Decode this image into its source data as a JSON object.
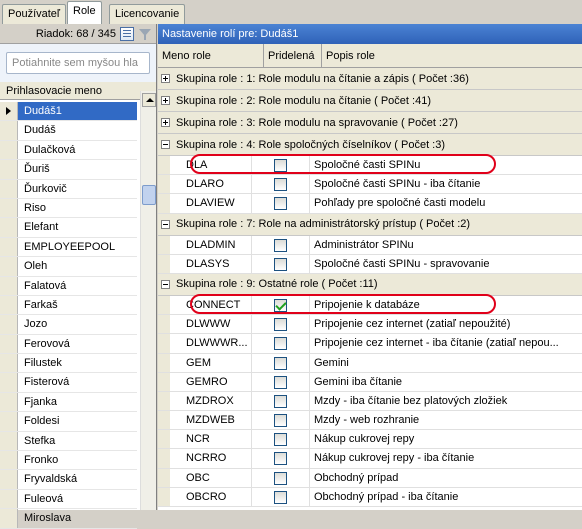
{
  "tabs": [
    "Používateľ",
    "Role",
    "Licencovanie"
  ],
  "left": {
    "row_info": "Riadok: 68 / 345",
    "search_placeholder": "Potiahnite sem myšou hla",
    "column_header": "Prihlasovacie meno",
    "users": [
      "Dudáš1",
      "Dudáš",
      "Dulačková",
      "Ďuriš",
      "Ďurkovič",
      "Riso",
      "Elefant",
      "EMPLOYEEPOOL",
      "Oleh",
      "Falatová",
      "Farkaš",
      "Jozo",
      "Ferovová",
      "Filustek",
      "Fisterová",
      "Fjanka",
      "Foldesi",
      "Stefka",
      "Fronko",
      "Fryvaldská",
      "Fuleová",
      "Miroslava"
    ],
    "selected_index": 0
  },
  "right": {
    "title": "Nastavenie rolí pre: Dudáš1",
    "columns": [
      "Meno role",
      "Pridelená",
      "Popis role"
    ],
    "groups": [
      {
        "label": "Skupina role : 1: Role modulu na čítanie a zápis ( Počet :36)",
        "expanded": false,
        "rows": []
      },
      {
        "label": "Skupina role : 2: Role modulu na čítanie ( Počet :41)",
        "expanded": false,
        "rows": []
      },
      {
        "label": "Skupina role : 3: Role modulu na spravovanie ( Počet :27)",
        "expanded": false,
        "rows": []
      },
      {
        "label": "Skupina role : 4: Role spoločných číselníkov ( Počet :3)",
        "expanded": true,
        "rows": [
          {
            "name": "DLA",
            "checked": false,
            "desc": "Spoločné časti SPINu",
            "highlight": true
          },
          {
            "name": "DLARO",
            "checked": false,
            "desc": "Spoločné časti SPINu - iba čítanie"
          },
          {
            "name": "DLAVIEW",
            "checked": false,
            "desc": "Pohľady pre spoločné časti modelu"
          }
        ]
      },
      {
        "label": "Skupina role : 7: Role na administrátorský prístup ( Počet :2)",
        "expanded": true,
        "rows": [
          {
            "name": "DLADMIN",
            "checked": false,
            "desc": "Administrátor SPINu"
          },
          {
            "name": "DLASYS",
            "checked": false,
            "desc": "Spoločné časti SPINu - spravovanie"
          }
        ]
      },
      {
        "label": "Skupina role : 9: Ostatné role ( Počet :11)",
        "expanded": true,
        "rows": [
          {
            "name": "CONNECT",
            "checked": true,
            "desc": "Pripojenie k databáze",
            "highlight": true
          },
          {
            "name": "DLWWW",
            "checked": false,
            "desc": "Pripojenie cez internet (zatiaľ nepoužité)"
          },
          {
            "name": "DLWWWR...",
            "checked": false,
            "desc": "Pripojenie cez internet - iba čítanie (zatiaľ nepou..."
          },
          {
            "name": "GEM",
            "checked": false,
            "desc": "Gemini"
          },
          {
            "name": "GEMRO",
            "checked": false,
            "desc": "Gemini iba čítanie"
          },
          {
            "name": "MZDROX",
            "checked": false,
            "desc": "Mzdy - iba čítanie bez platových zložiek"
          },
          {
            "name": "MZDWEB",
            "checked": false,
            "desc": "Mzdy - web rozhranie"
          },
          {
            "name": "NCR",
            "checked": false,
            "desc": "Nákup cukrovej repy"
          },
          {
            "name": "NCRRO",
            "checked": false,
            "desc": "Nákup cukrovej repy - iba čítanie"
          },
          {
            "name": "OBC",
            "checked": false,
            "desc": "Obchodný prípad"
          },
          {
            "name": "OBCRO",
            "checked": false,
            "desc": "Obchodný prípad - iba čítanie"
          }
        ]
      }
    ]
  }
}
